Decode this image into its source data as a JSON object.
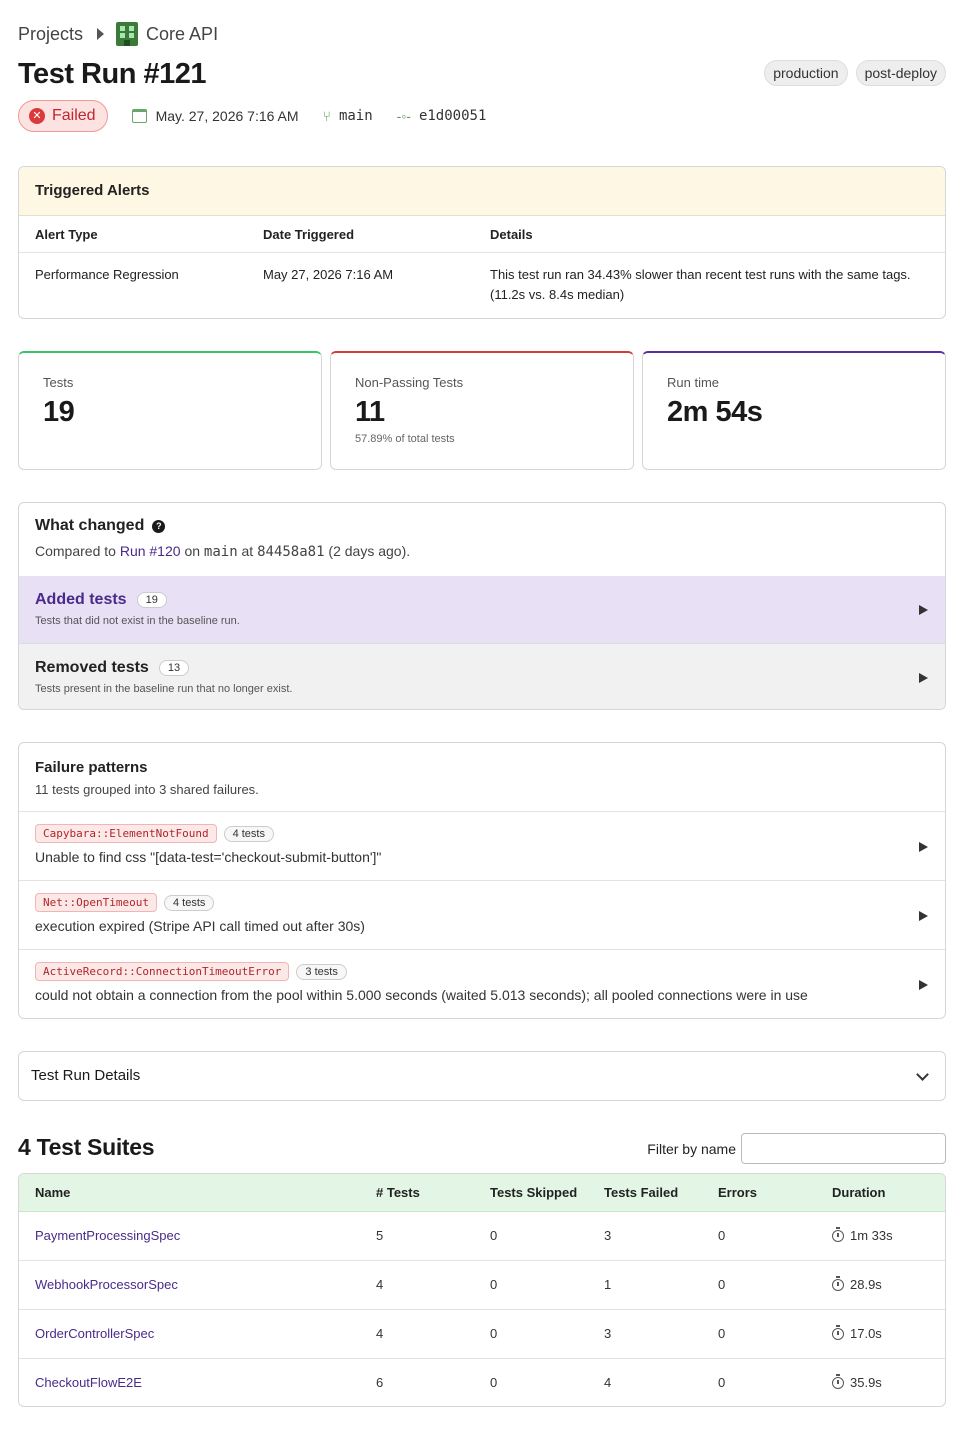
{
  "breadcrumb": {
    "root": "Projects",
    "project": "Core API"
  },
  "title": "Test Run #121",
  "tags": [
    "production",
    "post-deploy"
  ],
  "meta": {
    "status": "Failed",
    "date": "May. 27, 2026 7:16 AM",
    "branch": "main",
    "commit": "e1d00051"
  },
  "alerts": {
    "title": "Triggered Alerts",
    "columns": [
      "Alert Type",
      "Date Triggered",
      "Details"
    ],
    "rows": [
      {
        "type": "Performance Regression",
        "date": "May 27, 2026 7:16 AM",
        "details": "This test run ran 34.43% slower than recent test runs with the same tags. (11.2s vs. 8.4s median)"
      }
    ]
  },
  "stats": {
    "tests": {
      "label": "Tests",
      "value": "19",
      "color": "#3cc46a"
    },
    "non_passing": {
      "label": "Non-Passing Tests",
      "value": "11",
      "sub": "57.89% of total tests",
      "color": "#d43b3b"
    },
    "runtime": {
      "label": "Run time",
      "value": "2m 54s",
      "color": "#5b2d9e"
    }
  },
  "what_changed": {
    "title": "What changed",
    "compared_prefix": "Compared to",
    "run_link": "Run #120",
    "on": "on",
    "branch": "main",
    "at": "at",
    "commit": "84458a81",
    "ago": "(2 days ago).",
    "added": {
      "title": "Added tests",
      "count": "19",
      "desc": "Tests that did not exist in the baseline run."
    },
    "removed": {
      "title": "Removed tests",
      "count": "13",
      "desc": "Tests present in the baseline run that no longer exist."
    }
  },
  "failure_patterns": {
    "title": "Failure patterns",
    "desc": "11 tests grouped into 3 shared failures.",
    "items": [
      {
        "error": "Capybara::ElementNotFound",
        "count": "4 tests",
        "message": "Unable to find css \"[data-test='checkout-submit-button']\""
      },
      {
        "error": "Net::OpenTimeout",
        "count": "4 tests",
        "message": "execution expired (Stripe API call timed out after 30s)"
      },
      {
        "error": "ActiveRecord::ConnectionTimeoutError",
        "count": "3 tests",
        "message": "could not obtain a connection from the pool within 5.000 seconds (waited 5.013 seconds); all pooled connections were in use"
      }
    ]
  },
  "details_section": {
    "title": "Test Run Details"
  },
  "suites": {
    "title": "4 Test Suites",
    "filter_label": "Filter by name",
    "filter_value": "",
    "columns": [
      "Name",
      "# Tests",
      "Tests Skipped",
      "Tests Failed",
      "Errors",
      "Duration"
    ],
    "rows": [
      {
        "name": "PaymentProcessingSpec",
        "tests": "5",
        "skipped": "0",
        "failed": "3",
        "errors": "0",
        "duration": "1m 33s"
      },
      {
        "name": "WebhookProcessorSpec",
        "tests": "4",
        "skipped": "0",
        "failed": "1",
        "errors": "0",
        "duration": "28.9s"
      },
      {
        "name": "OrderControllerSpec",
        "tests": "4",
        "skipped": "0",
        "failed": "3",
        "errors": "0",
        "duration": "17.0s"
      },
      {
        "name": "CheckoutFlowE2E",
        "tests": "6",
        "skipped": "0",
        "failed": "4",
        "errors": "0",
        "duration": "35.9s"
      }
    ]
  }
}
